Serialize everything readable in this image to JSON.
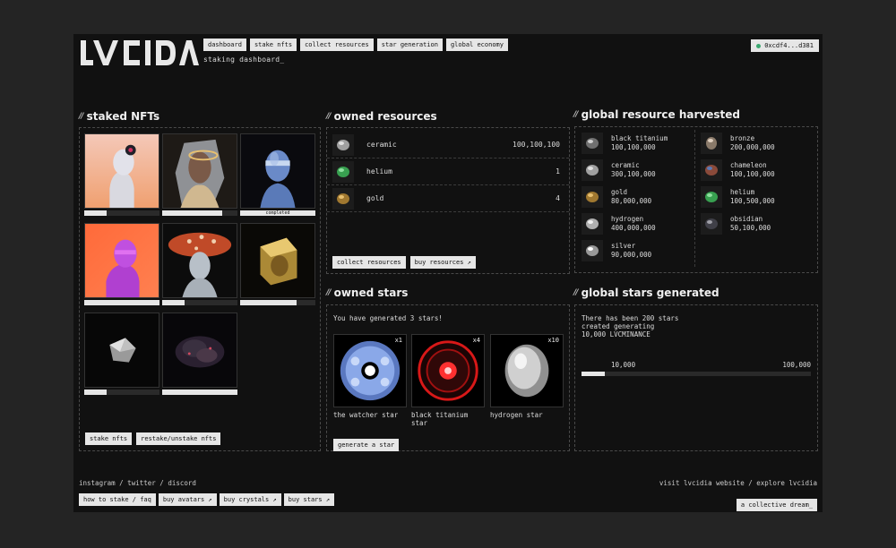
{
  "brand": {
    "subtitle": "staking dashboard_"
  },
  "nav": [
    {
      "label": "dashboard"
    },
    {
      "label": "stake nfts"
    },
    {
      "label": "collect resources"
    },
    {
      "label": "star generation"
    },
    {
      "label": "global economy"
    }
  ],
  "wallet": {
    "address": "0xcdf4...d381",
    "status_color": "#3aa870"
  },
  "staked": {
    "title": "staked NFTs",
    "items": [
      {
        "progress": 0.3
      },
      {
        "progress": 0.8
      },
      {
        "progress": 1.0,
        "status": "completed"
      },
      {
        "progress": 1.0
      },
      {
        "progress": 0.3
      },
      {
        "progress": 0.75
      },
      {
        "progress": 0.3
      },
      {
        "progress": 1.0
      }
    ],
    "buttons": {
      "stake": "stake nfts",
      "restake": "restake/unstake nfts"
    }
  },
  "owned_resources": {
    "title": "owned resources",
    "rows": [
      {
        "name": "ceramic",
        "qty": "100,100,100",
        "icon": "ceramic-icon"
      },
      {
        "name": "helium",
        "qty": "1",
        "icon": "helium-icon"
      },
      {
        "name": "gold",
        "qty": "4",
        "icon": "gold-icon"
      }
    ],
    "buttons": {
      "collect": "collect resources",
      "buy": "buy resources ↗"
    }
  },
  "global_resources": {
    "title": "global resource harvested",
    "items": [
      {
        "name": "black titanium",
        "value": "100,100,000"
      },
      {
        "name": "bronze",
        "value": "200,000,000"
      },
      {
        "name": "ceramic",
        "value": "300,100,000"
      },
      {
        "name": "chameleon",
        "value": "100,100,000"
      },
      {
        "name": "gold",
        "value": "80,000,000"
      },
      {
        "name": "helium",
        "value": "100,500,000"
      },
      {
        "name": "hydrogen",
        "value": "400,000,000"
      },
      {
        "name": "obsidian",
        "value": "50,100,000"
      },
      {
        "name": "silver",
        "value": "90,000,000"
      }
    ]
  },
  "owned_stars": {
    "title": "owned stars",
    "message": "You have generated 3 stars!",
    "stars": [
      {
        "name": "the watcher star",
        "mult": "x1"
      },
      {
        "name": "black titanium star",
        "mult": "x4"
      },
      {
        "name": "hydrogen star",
        "mult": "x10"
      }
    ],
    "button": "generate a star"
  },
  "global_stars": {
    "title": "global stars generated",
    "line1": "There has been 200 stars",
    "line2": "created generating",
    "line3": "10,000 LVCMINANCE",
    "progress_label": "10,000",
    "max_label": "100,000",
    "progress": 0.1
  },
  "footer": {
    "social": "instagram / twitter / discord",
    "links": [
      {
        "label": "how to stake / faq"
      },
      {
        "label": "buy avatars ↗"
      },
      {
        "label": "buy crystals ↗"
      },
      {
        "label": "buy stars ↗"
      }
    ],
    "website": "visit lvcidia website / explore lvcidia",
    "collective": "a collective dream_"
  }
}
